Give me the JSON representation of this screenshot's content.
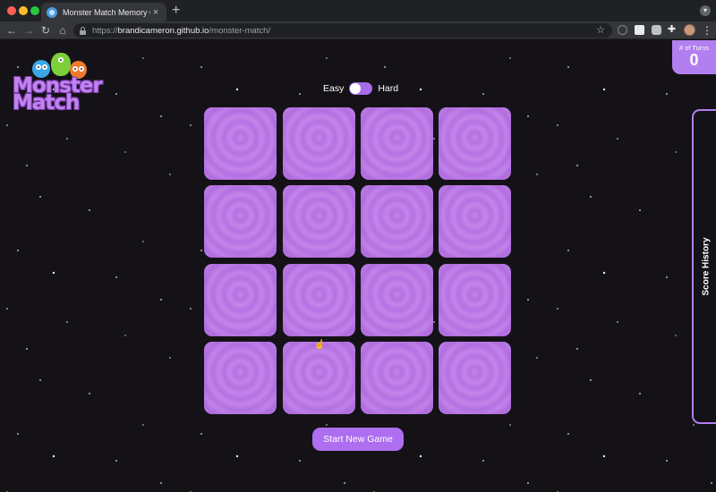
{
  "browser": {
    "tab_title": "Monster Match Memory Game",
    "tab_close": "×",
    "new_tab": "+",
    "url_scheme": "https://",
    "url_host": "brandicameron.github.io",
    "url_path": "/monster-match/",
    "nav": {
      "back": "←",
      "forward": "→",
      "reload": "↻",
      "home": "⌂"
    },
    "star": "☆",
    "menu": "⋮",
    "puzzle": "✚",
    "profile_menu": "▾",
    "icons": [
      "lock-icon",
      "star-icon",
      "puzzle-icon",
      "camera-icon",
      "kebab-menu-icon"
    ]
  },
  "game": {
    "logo_text_line1": "Monster",
    "logo_text_line2": "Match",
    "turns_label": "# of Turns",
    "turns_value": "0",
    "mode_easy": "Easy",
    "mode_hard": "Hard",
    "mode_selected": "Easy",
    "start_button": "Start New Game",
    "score_history": "Score History",
    "card_count": 16,
    "card_state": "face-down",
    "colors": {
      "accent": "#b27ff0",
      "card": "#c286ea",
      "background": "#141216"
    }
  },
  "cursor": "☝"
}
